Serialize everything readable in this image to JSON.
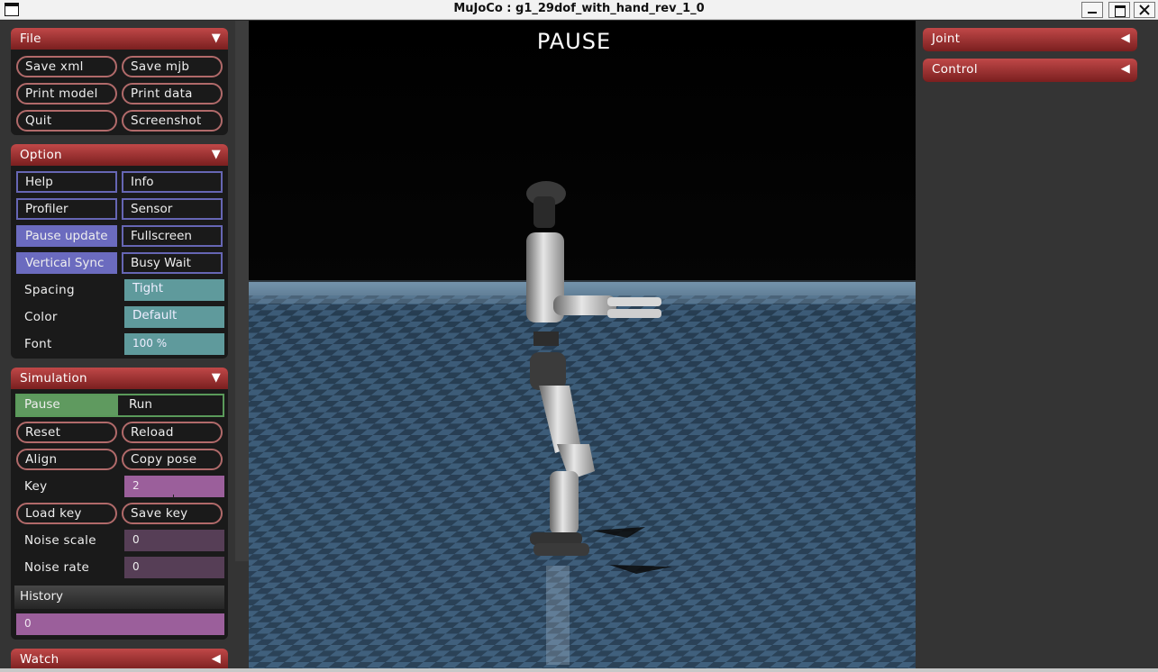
{
  "window": {
    "title": "MuJoCo : g1_29dof_with_hand_rev_1_0"
  },
  "viewport": {
    "status_text": "PAUSE"
  },
  "file_section": {
    "title": "File",
    "buttons": [
      "Save xml",
      "Save mjb",
      "Print model",
      "Print data",
      "Quit",
      "Screenshot"
    ]
  },
  "option_section": {
    "title": "Option",
    "checkboxes": [
      {
        "label": "Help",
        "checked": false
      },
      {
        "label": "Info",
        "checked": false
      },
      {
        "label": "Profiler",
        "checked": false
      },
      {
        "label": "Sensor",
        "checked": false
      },
      {
        "label": "Pause update",
        "checked": true
      },
      {
        "label": "Fullscreen",
        "checked": false
      },
      {
        "label": "Vertical Sync",
        "checked": true
      },
      {
        "label": "Busy Wait",
        "checked": false
      }
    ],
    "spacing": {
      "label": "Spacing",
      "value": "Tight"
    },
    "color": {
      "label": "Color",
      "value": "Default"
    },
    "font": {
      "label": "Font",
      "value": "100 %"
    }
  },
  "simulation_section": {
    "title": "Simulation",
    "pause_label": "Pause",
    "run_label": "Run",
    "selected_mode": "Pause",
    "buttons": [
      "Reset",
      "Reload",
      "Align",
      "Copy pose"
    ],
    "key": {
      "label": "Key",
      "value": "2"
    },
    "key_buttons": [
      "Load key",
      "Save key"
    ],
    "noise_scale": {
      "label": "Noise scale",
      "value": "0"
    },
    "noise_rate": {
      "label": "Noise rate",
      "value": "0"
    },
    "history": {
      "label": "History",
      "value": "0"
    }
  },
  "watch_section": {
    "title": "Watch"
  },
  "right_sections": [
    {
      "title": "Joint"
    },
    {
      "title": "Control"
    }
  ],
  "colors": {
    "section_header": "#a83a3a",
    "checkbox_on": "#6b6bbf",
    "select_bg": "#5f9a9c",
    "slider_bg": "#9b5f9b",
    "radio_on": "#5f9a5f"
  }
}
